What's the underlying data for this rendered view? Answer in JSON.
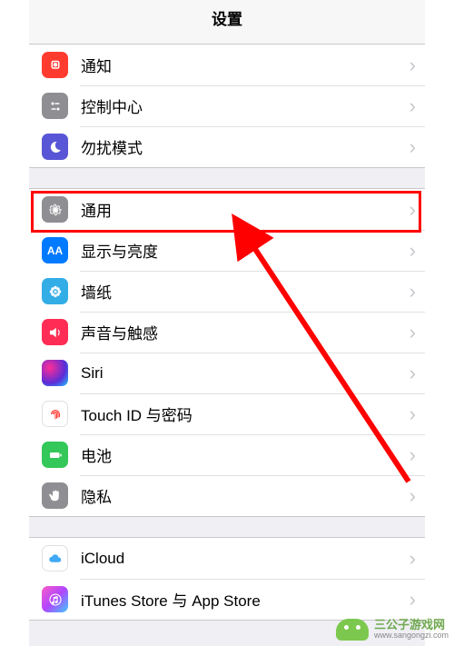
{
  "header": {
    "title": "设置"
  },
  "groups": [
    {
      "items": [
        {
          "id": "notifications",
          "label": "通知"
        },
        {
          "id": "control-center",
          "label": "控制中心"
        },
        {
          "id": "dnd",
          "label": "勿扰模式"
        }
      ]
    },
    {
      "items": [
        {
          "id": "general",
          "label": "通用"
        },
        {
          "id": "display",
          "label": "显示与亮度"
        },
        {
          "id": "wallpaper",
          "label": "墙纸"
        },
        {
          "id": "sounds",
          "label": "声音与触感"
        },
        {
          "id": "siri",
          "label": "Siri"
        },
        {
          "id": "touchid",
          "label": "Touch ID 与密码"
        },
        {
          "id": "battery",
          "label": "电池"
        },
        {
          "id": "privacy",
          "label": "隐私"
        }
      ]
    },
    {
      "items": [
        {
          "id": "icloud",
          "label": "iCloud"
        },
        {
          "id": "itunes",
          "label": "iTunes Store 与 App Store"
        }
      ]
    }
  ],
  "annotation": {
    "highlighted_item_id": "general"
  },
  "watermark": {
    "name": "三公子游戏网",
    "url": "www.sangongzi.com"
  }
}
